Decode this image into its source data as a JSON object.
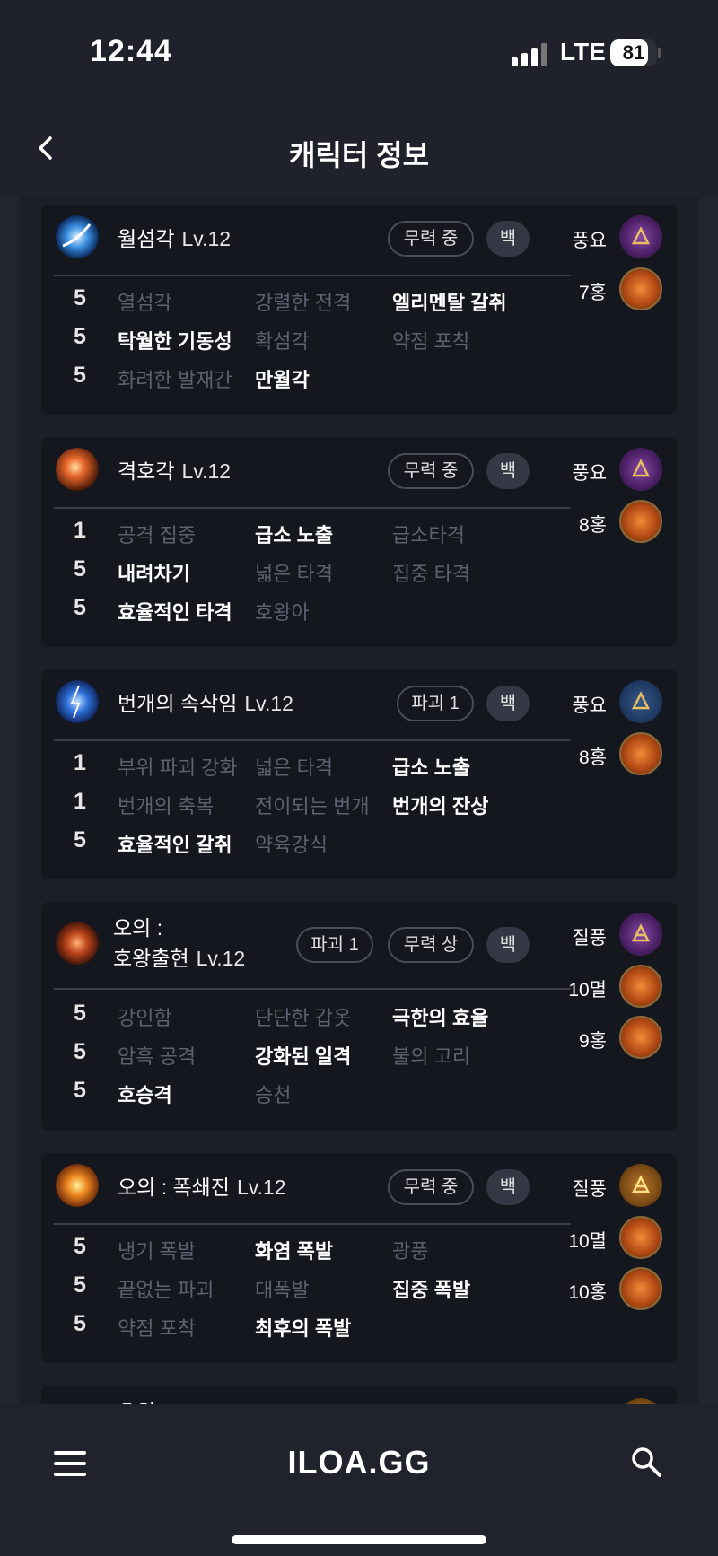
{
  "status": {
    "time": "12:44",
    "network": "LTE",
    "battery": "81"
  },
  "header": {
    "title": "캐릭터 정보"
  },
  "skills": [
    {
      "name": "월섬각",
      "level": "Lv.12",
      "tags": [
        "무력 중",
        "백"
      ],
      "tripods": [
        {
          "level": "5",
          "options": [
            {
              "label": "열섬각",
              "active": false
            },
            {
              "label": "강렬한 전격",
              "active": false
            },
            {
              "label": "엘리멘탈 갈취",
              "active": true
            }
          ]
        },
        {
          "level": "5",
          "options": [
            {
              "label": "탁월한 기동성",
              "active": true
            },
            {
              "label": "확섬각",
              "active": false
            },
            {
              "label": "약점 포착",
              "active": false
            }
          ]
        },
        {
          "level": "5",
          "options": [
            {
              "label": "화려한 발재간",
              "active": false
            },
            {
              "label": "만월각",
              "active": true
            }
          ]
        }
      ],
      "rune": "풍요",
      "gems": [
        "7홍"
      ]
    },
    {
      "name": "격호각",
      "level": "Lv.12",
      "tags": [
        "무력 중",
        "백"
      ],
      "tripods": [
        {
          "level": "1",
          "options": [
            {
              "label": "공격 집중",
              "active": false
            },
            {
              "label": "급소 노출",
              "active": true
            },
            {
              "label": "급소타격",
              "active": false
            }
          ]
        },
        {
          "level": "5",
          "options": [
            {
              "label": "내려차기",
              "active": true
            },
            {
              "label": "넓은 타격",
              "active": false
            },
            {
              "label": "집중 타격",
              "active": false
            }
          ]
        },
        {
          "level": "5",
          "options": [
            {
              "label": "효율적인 타격",
              "active": true
            },
            {
              "label": "호왕아",
              "active": false
            }
          ]
        }
      ],
      "rune": "풍요",
      "gems": [
        "8홍"
      ]
    },
    {
      "name": "번개의 속삭임",
      "level": "Lv.12",
      "tags": [
        "파괴 1",
        "백"
      ],
      "tripods": [
        {
          "level": "1",
          "options": [
            {
              "label": "부위 파괴 강화",
              "active": false
            },
            {
              "label": "넓은 타격",
              "active": false
            },
            {
              "label": "급소 노출",
              "active": true
            }
          ]
        },
        {
          "level": "1",
          "options": [
            {
              "label": "번개의 축복",
              "active": false
            },
            {
              "label": "전이되는 번개",
              "active": false
            },
            {
              "label": "번개의 잔상",
              "active": true
            }
          ]
        },
        {
          "level": "5",
          "options": [
            {
              "label": "효율적인 갈취",
              "active": true
            },
            {
              "label": "약육강식",
              "active": false
            }
          ]
        }
      ],
      "rune": "풍요",
      "gems": [
        "8홍"
      ]
    },
    {
      "name_line1": "오의 :",
      "name_line2": "호왕출현",
      "level": "Lv.12",
      "tags": [
        "파괴 1",
        "무력 상",
        "백"
      ],
      "tripods": [
        {
          "level": "5",
          "options": [
            {
              "label": "강인함",
              "active": false
            },
            {
              "label": "단단한 갑옷",
              "active": false
            },
            {
              "label": "극한의 효율",
              "active": true
            }
          ]
        },
        {
          "level": "5",
          "options": [
            {
              "label": "암흑 공격",
              "active": false
            },
            {
              "label": "강화된 일격",
              "active": true
            },
            {
              "label": "불의 고리",
              "active": false
            }
          ]
        },
        {
          "level": "5",
          "options": [
            {
              "label": "호승격",
              "active": true
            },
            {
              "label": "승천",
              "active": false
            }
          ]
        }
      ],
      "rune": "질풍",
      "gems": [
        "10멸",
        "9홍"
      ]
    },
    {
      "name": "오의 : 폭쇄진",
      "level": "Lv.12",
      "tags": [
        "무력 중",
        "백"
      ],
      "tripods": [
        {
          "level": "5",
          "options": [
            {
              "label": "냉기 폭발",
              "active": false
            },
            {
              "label": "화염 폭발",
              "active": true
            },
            {
              "label": "광풍",
              "active": false
            }
          ]
        },
        {
          "level": "5",
          "options": [
            {
              "label": "끝없는 파괴",
              "active": false
            },
            {
              "label": "대폭발",
              "active": false
            },
            {
              "label": "집중 폭발",
              "active": true
            }
          ]
        },
        {
          "level": "5",
          "options": [
            {
              "label": "약점 포착",
              "active": false
            },
            {
              "label": "최후의 폭발",
              "active": true
            }
          ]
        }
      ],
      "rune": "질풍",
      "gems": [
        "10멸",
        "10홍"
      ]
    },
    {
      "name": "오의"
    }
  ],
  "footer": {
    "logo": "ILOA.GG"
  },
  "icons": {
    "back": "chevron-left-icon",
    "menu": "hamburger-menu-icon",
    "search": "search-icon"
  }
}
